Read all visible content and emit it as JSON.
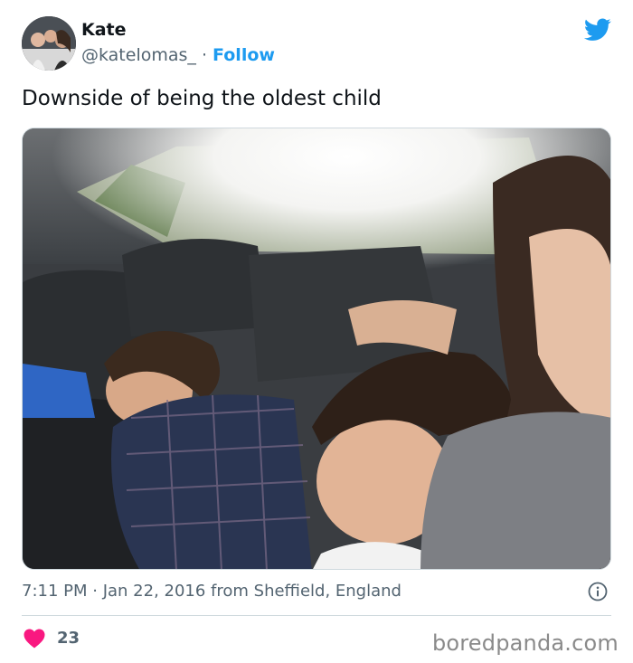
{
  "tweet": {
    "author": {
      "display_name": "Kate",
      "handle": "@katelomas_",
      "separator": "·",
      "follow_label": "Follow",
      "avatar_icon": "profile-photo"
    },
    "brand_icon": "twitter-bird-icon",
    "brand_color": "#1d9bf0",
    "text": "Downside of being the oldest child",
    "timestamp": "7:11 PM · Jan 22, 2016 from Sheffield, England",
    "info_icon": "info-icon",
    "like_icon": "heart-icon",
    "like_color": "#f91880",
    "like_count": "23"
  },
  "watermark": "boredpanda.com"
}
